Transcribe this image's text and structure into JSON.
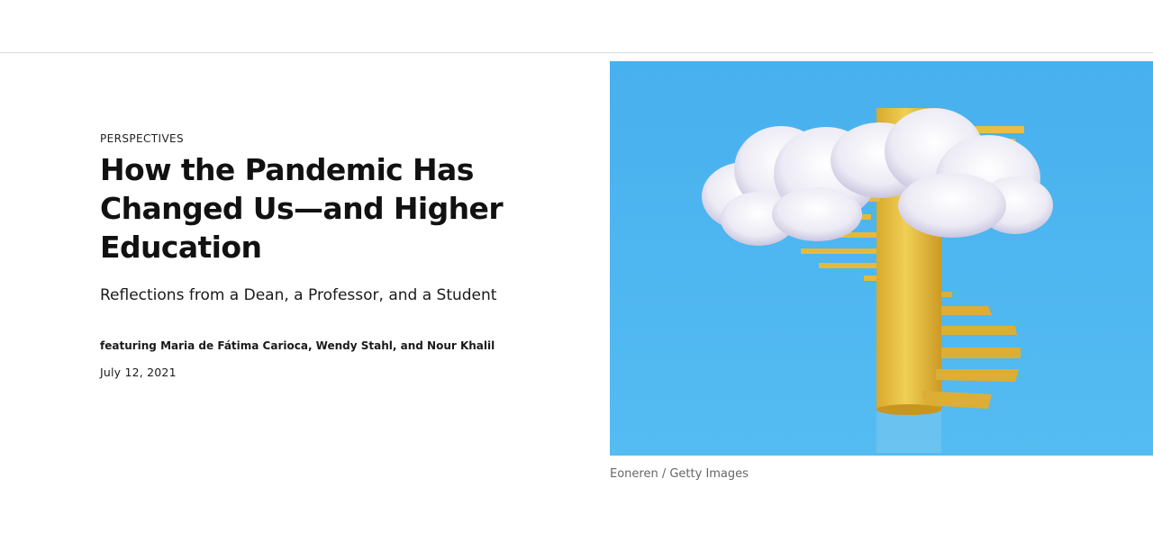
{
  "article": {
    "category": "PERSPECTIVES",
    "title": "How the Pandemic Has Changed Us—and Higher Education",
    "subtitle": "Reflections from a Dean, a Professor, and a Student",
    "byline": "featuring Maria de Fátima Carioca, Wendy Stahl, and Nour Khalil",
    "date": "July 12, 2021"
  },
  "hero_image": {
    "credit": "Eoneren / Getty Images",
    "colors": {
      "sky": "#4cb4ef",
      "pillar": "#e9c341",
      "cloud": "#f1f1f7"
    }
  }
}
